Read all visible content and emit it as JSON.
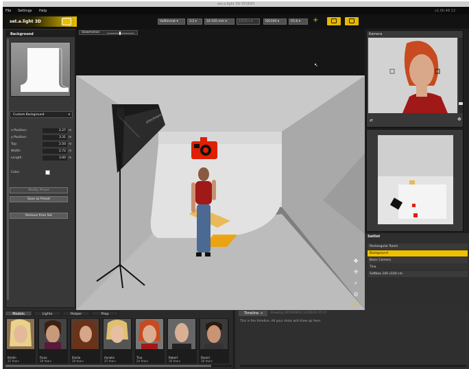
{
  "window": {
    "title": "set.a.light 3D STUDIO",
    "clock": "v1.00.48  13"
  },
  "menu": [
    "File",
    "Settings",
    "Help"
  ],
  "logo": "set.a.light 3D",
  "toolbar": {
    "camera": "Vollformat",
    "ratio": "3:2",
    "lens": "24-105 mm",
    "shutter": "1/125 s",
    "iso": "ISO100",
    "aperture": "f/5.6"
  },
  "left_panel": {
    "header": "Background",
    "background_select": "Custom Background",
    "fields": [
      {
        "label": "x-Position:",
        "value": "2.27",
        "unit": "m"
      },
      {
        "label": "y-Position:",
        "value": "3.31",
        "unit": "m"
      },
      {
        "label": "Top:",
        "value": "2.50",
        "unit": "m"
      },
      {
        "label": "Width:",
        "value": "2.72",
        "unit": "m"
      },
      {
        "label": "Length:",
        "value": "3.00",
        "unit": "m"
      }
    ],
    "color_label": "Color:",
    "buttons": {
      "modify": "Modify Preset",
      "save": "Save as Preset",
      "remove": "Remove from Set"
    }
  },
  "viewport": {
    "slider_label": "Slowmotion",
    "softbox_brand": "elinchrom"
  },
  "camera_panel": {
    "header": "Kamera"
  },
  "setlist": {
    "header": "Setlist",
    "items": [
      "Rectangular Room",
      "Background",
      "Basic Camera",
      "Tina",
      "Softbox 100 x100 cm"
    ],
    "selected_index": 1
  },
  "bottom": {
    "tabs": [
      "Models",
      "Lights",
      "Helper",
      "Prop"
    ],
    "active_tab": "Models",
    "models": [
      {
        "name": "Kristin",
        "age": "25 Years"
      },
      {
        "name": "Fiona",
        "age": "28 Years"
      },
      {
        "name": "Emilia",
        "age": "28 Years"
      },
      {
        "name": "Annelie",
        "age": "25 Years"
      },
      {
        "name": "Tina",
        "age": "24 Years"
      },
      {
        "name": "Robert",
        "age": "36 Years"
      },
      {
        "name": "Daniel",
        "age": "28 Years"
      }
    ],
    "timeline_label": "Timeline",
    "timeline_count": "Showing 2019/09/01 13:00:03 15:17",
    "timeline_msg": "This is the timeline. All your shots will show up here."
  },
  "colors": {
    "accent": "#e8c000",
    "selection": "#f0c000",
    "marker": "#e02000"
  }
}
